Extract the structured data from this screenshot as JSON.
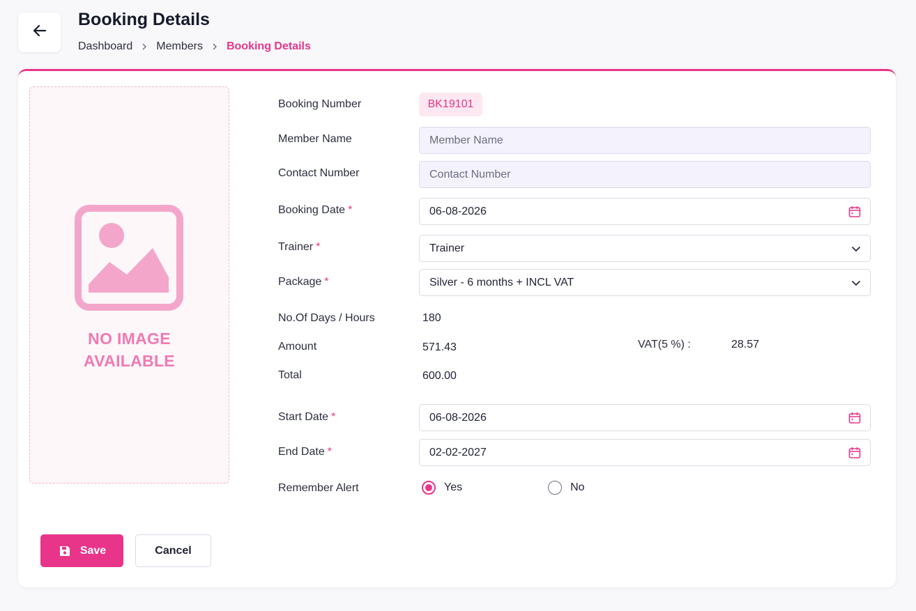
{
  "header": {
    "title": "Booking Details",
    "breadcrumb": [
      "Dashboard",
      "Members",
      "Booking Details"
    ]
  },
  "image_placeholder": {
    "line1": "NO IMAGE",
    "line2": "AVAILABLE"
  },
  "form": {
    "booking_number": {
      "label": "Booking Number",
      "value": "BK19101"
    },
    "member_name": {
      "label": "Member Name",
      "placeholder": "Member Name"
    },
    "contact_number": {
      "label": "Contact Number",
      "placeholder": "Contact Number"
    },
    "booking_date": {
      "label": "Booking Date",
      "value": "06-08-2026"
    },
    "trainer": {
      "label": "Trainer",
      "value": "Trainer"
    },
    "package": {
      "label": "Package",
      "value": "Silver - 6 months + INCL VAT"
    },
    "days_hours": {
      "label": "No.Of Days / Hours",
      "value": "180"
    },
    "amount": {
      "label": "Amount",
      "value": "571.43"
    },
    "vat": {
      "label": "VAT(5 %) :",
      "value": "28.57"
    },
    "total": {
      "label": "Total",
      "value": "600.00"
    },
    "start_date": {
      "label": "Start Date",
      "value": "06-08-2026"
    },
    "end_date": {
      "label": "End Date",
      "value": "02-02-2027"
    },
    "remember_alert": {
      "label": "Remember Alert",
      "options": [
        "Yes",
        "No"
      ],
      "selected": "Yes"
    },
    "required_mark": "*"
  },
  "actions": {
    "save": "Save",
    "cancel": "Cancel"
  },
  "colors": {
    "accent": "#e8358a",
    "accent_light": "#fde7f1",
    "readonly_bg": "#f4f2fd",
    "placeholder_pink": "#f07ab2"
  },
  "icons": {
    "back": "arrow-left-icon",
    "breadcrumb_separator": "chevron-right-icon",
    "date": "calendar-icon",
    "select": "chevron-down-icon",
    "image": "image-placeholder-icon",
    "save": "floppy-disk-icon"
  }
}
